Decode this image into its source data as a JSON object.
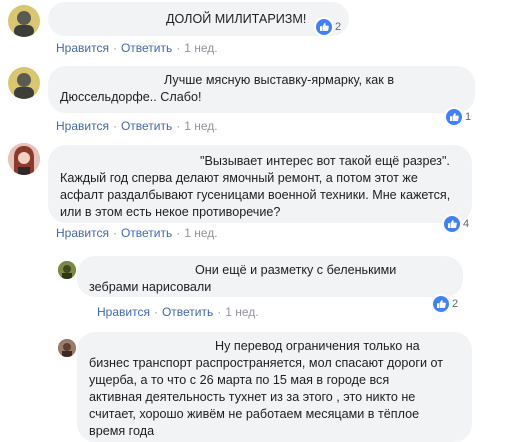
{
  "actions": {
    "like": "Нравится",
    "reply": "Ответить",
    "separator": "·",
    "time": "1 нед."
  },
  "comments": [
    {
      "text": "ДОЛОЙ МИЛИТАРИЗМ!",
      "reactions": "2"
    },
    {
      "text": "Лучше мясную выставку-ярмарку, как в\nДюссельдорфе.. Слабо!",
      "reactions": "1"
    },
    {
      "text": "\"Вызывает интерес вот такой ещё разрез\".\nКаждый год сперва делают ямочный ремонт, а потом этот же\nасфалт раздалбывают гусеницами военной техники. Мне кажется,\nили в этом есть некое противоречие?",
      "reactions": "4"
    },
    {
      "text": "Они ещё и разметку с беленькими\nзебрами нарисовали",
      "reactions": "2"
    },
    {
      "text": "Ну перевод ограничения только на\nбизнес транспорт распространяется, мол спасают дороги от\nущерба, а то что с 26 марта по 15 мая в городе вся\nактивная деятельность тухнет из за этого , это никто не\nсчитает, хорошо живём не работаем месяцами в тёплое\nвремя года"
    }
  ],
  "colors": {
    "link": "#4267b2",
    "meta": "#90949c",
    "bubble": "#f2f3f5",
    "like": "#4080ff"
  }
}
